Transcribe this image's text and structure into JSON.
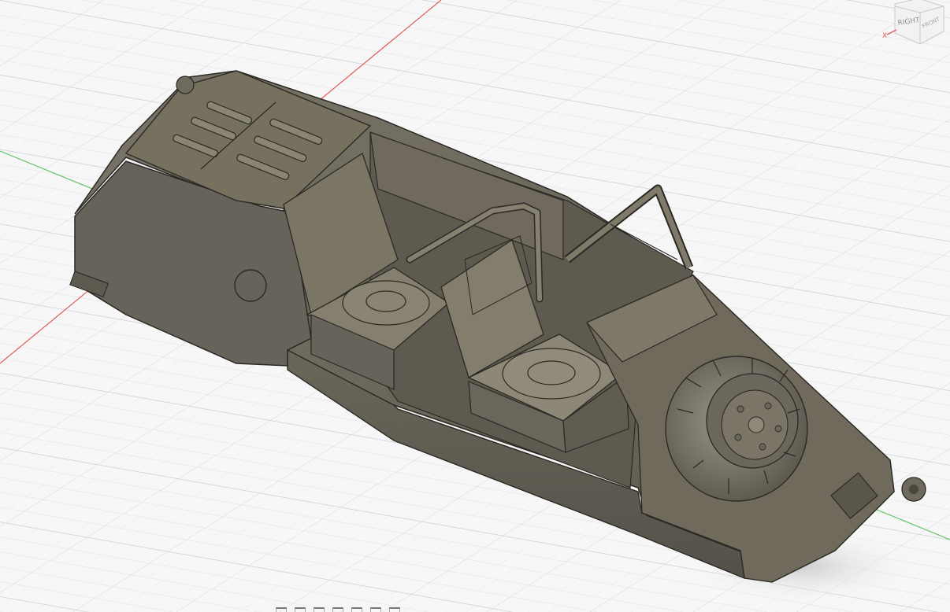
{
  "viewport": {
    "background": "#f7f7f8",
    "grid_minor": "#e2e3e6",
    "grid_major": "#c9cbd0",
    "axis_x_color": "#e05a5a",
    "axis_y_color": "#63c46a",
    "model_color": "#6b665a"
  },
  "viewcube": {
    "face_label_right": "RIGHT",
    "face_label_front": "FRONT",
    "axis_label_x": "X"
  },
  "toolbar": {
    "icons": [
      "orbit-icon",
      "pan-icon",
      "zoom-icon",
      "fit-icon",
      "display-settings-icon",
      "grid-settings-icon",
      "viewports-icon"
    ]
  }
}
